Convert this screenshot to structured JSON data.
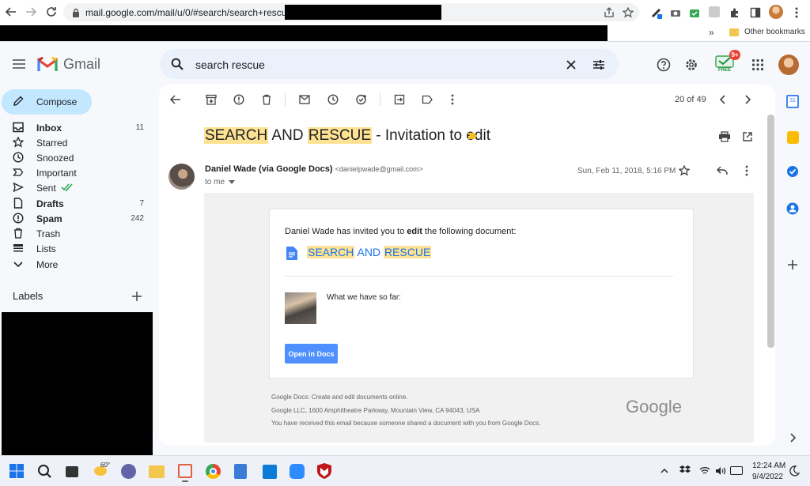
{
  "browser": {
    "url": "mail.google.com/mail/u/0/#search/search+rescue/",
    "bookmarks_overflow": "»",
    "other_bookmarks": "Other bookmarks"
  },
  "app": {
    "name": "Gmail"
  },
  "search": {
    "query": "search rescue"
  },
  "upgrade_badge": {
    "count": "9+",
    "label": "FREE"
  },
  "sidebar": {
    "compose": "Compose",
    "items": [
      {
        "label": "Inbox",
        "count": "11",
        "bold": true,
        "icon": "inbox-icon"
      },
      {
        "label": "Starred",
        "count": "",
        "bold": false,
        "icon": "star-icon"
      },
      {
        "label": "Snoozed",
        "count": "",
        "bold": false,
        "icon": "clock-icon"
      },
      {
        "label": "Important",
        "count": "",
        "bold": false,
        "icon": "important-icon"
      },
      {
        "label": "Sent",
        "count": "",
        "bold": false,
        "icon": "send-icon"
      },
      {
        "label": "Drafts",
        "count": "7",
        "bold": true,
        "icon": "draft-icon"
      },
      {
        "label": "Spam",
        "count": "242",
        "bold": true,
        "icon": "spam-icon"
      },
      {
        "label": "Trash",
        "count": "",
        "bold": false,
        "icon": "trash-icon"
      },
      {
        "label": "Lists",
        "count": "",
        "bold": false,
        "icon": "list-icon"
      },
      {
        "label": "More",
        "count": "",
        "bold": false,
        "icon": "chevron-down-icon"
      }
    ],
    "labels_heading": "Labels"
  },
  "toolbar": {
    "pagination": "20 of 49"
  },
  "email": {
    "subject_part1": "SEARCH",
    "subject_part2": "AND",
    "subject_part3": "RESCUE",
    "subject_rest": " - Invitation to edit",
    "sender_name": "Daniel Wade (via Google Docs)",
    "sender_email": "<danielpwade@gmail.com>",
    "date": "Sun, Feb 11, 2018, 5:16 PM",
    "to": "to me",
    "invite_prefix": "Daniel Wade has invited you to ",
    "invite_bold": "edit",
    "invite_suffix": " the following document:",
    "doc_word1": "SEARCH",
    "doc_word2": "AND",
    "doc_word3": "RESCUE",
    "message": "What we have so far:",
    "open_button": "Open in Docs",
    "footer1": "Google Docs: Create and edit documents online.",
    "footer2": "Google LLC, 1600 Amphitheatre Parkway, Mountain View, CA 94043, USA",
    "footer3": "You have received this email because someone shared a document with you from Google Docs.",
    "google_logo": "Google"
  },
  "taskbar": {
    "time": "12:24 AM",
    "date": "9/4/2022",
    "weather": "60°"
  },
  "colors": {
    "accent": "#0b57d0",
    "highlight": "#fde293",
    "compose_bg": "#c2e7ff",
    "docs_button": "#4d90fe"
  }
}
